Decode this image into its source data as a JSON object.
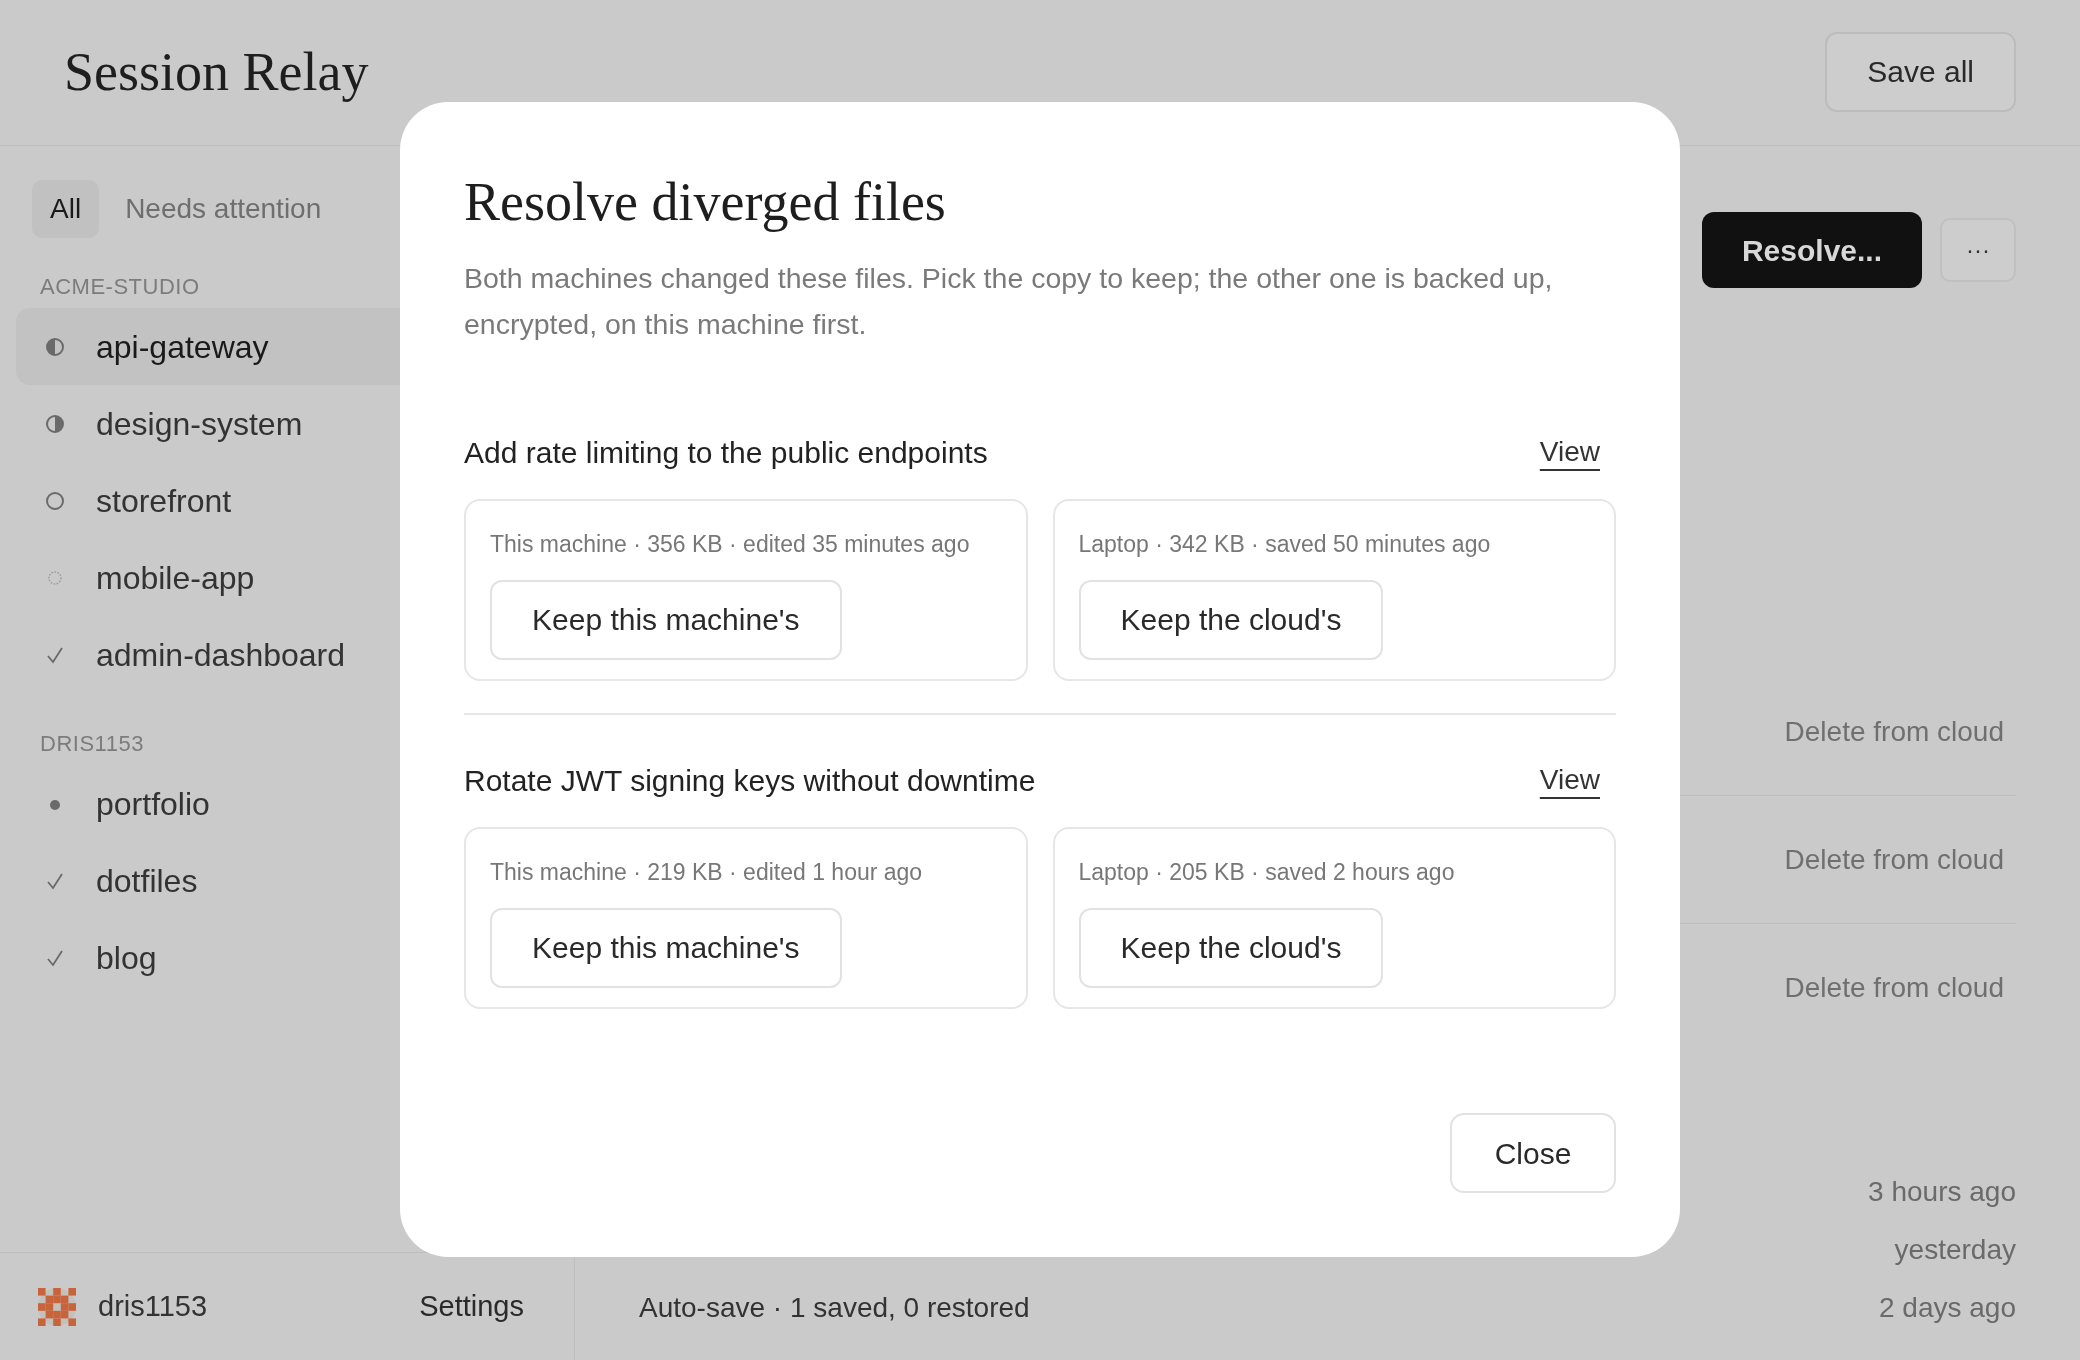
{
  "app": {
    "title": "Session Relay",
    "save_button": "Save all"
  },
  "sidebar": {
    "tabs": [
      {
        "label": "All",
        "selected": true
      },
      {
        "label": "Needs attention",
        "selected": false
      }
    ],
    "groups": [
      {
        "label": "ACME-STUDIO",
        "items": [
          {
            "name": "api-gateway",
            "kind": "halfleft",
            "selected": true
          },
          {
            "name": "design-system",
            "kind": "halfright",
            "selected": false
          },
          {
            "name": "storefront",
            "kind": "empty",
            "selected": false
          },
          {
            "name": "mobile-app",
            "kind": "dotted",
            "selected": false
          },
          {
            "name": "admin-dashboard",
            "kind": "check",
            "selected": false
          }
        ]
      },
      {
        "label": "DRIS1153",
        "items": [
          {
            "name": "portfolio",
            "kind": "dot",
            "selected": false
          },
          {
            "name": "dotfiles",
            "kind": "check",
            "selected": false
          },
          {
            "name": "blog",
            "kind": "check",
            "selected": false
          }
        ]
      }
    ],
    "footer": {
      "user": "dris1153",
      "settings": "Settings"
    }
  },
  "toolbar": {
    "resolve_button": "Resolve...",
    "more_button": "···"
  },
  "rows": [
    {
      "action": "Delete from cloud"
    },
    {
      "action": "Delete from cloud"
    },
    {
      "action": "Delete from cloud"
    }
  ],
  "activity": [
    {
      "time": "3 hours ago"
    },
    {
      "time": "yesterday"
    },
    {
      "text": "Auto-save · 1 saved, 0 restored",
      "time": "2 days ago"
    }
  ],
  "dialog": {
    "title": "Resolve diverged files",
    "description": "Both machines changed these files. Pick the copy to keep; the other one is backed up, encrypted, on this machine first.",
    "conflicts": [
      {
        "title": "Add rate limiting to the public endpoints",
        "view": "View",
        "options": [
          {
            "meta": "This machine · 356 KB · edited 35 minutes ago",
            "button": "Keep this machine's"
          },
          {
            "meta": "Laptop · 342 KB · saved 50 minutes ago",
            "button": "Keep the cloud's"
          }
        ]
      },
      {
        "title": "Rotate JWT signing keys without downtime",
        "view": "View",
        "options": [
          {
            "meta": "This machine · 219 KB · edited 1 hour ago",
            "button": "Keep this machine's"
          },
          {
            "meta": "Laptop · 205 KB · saved 2 hours ago",
            "button": "Keep the cloud's"
          }
        ]
      }
    ],
    "close": "Close"
  }
}
